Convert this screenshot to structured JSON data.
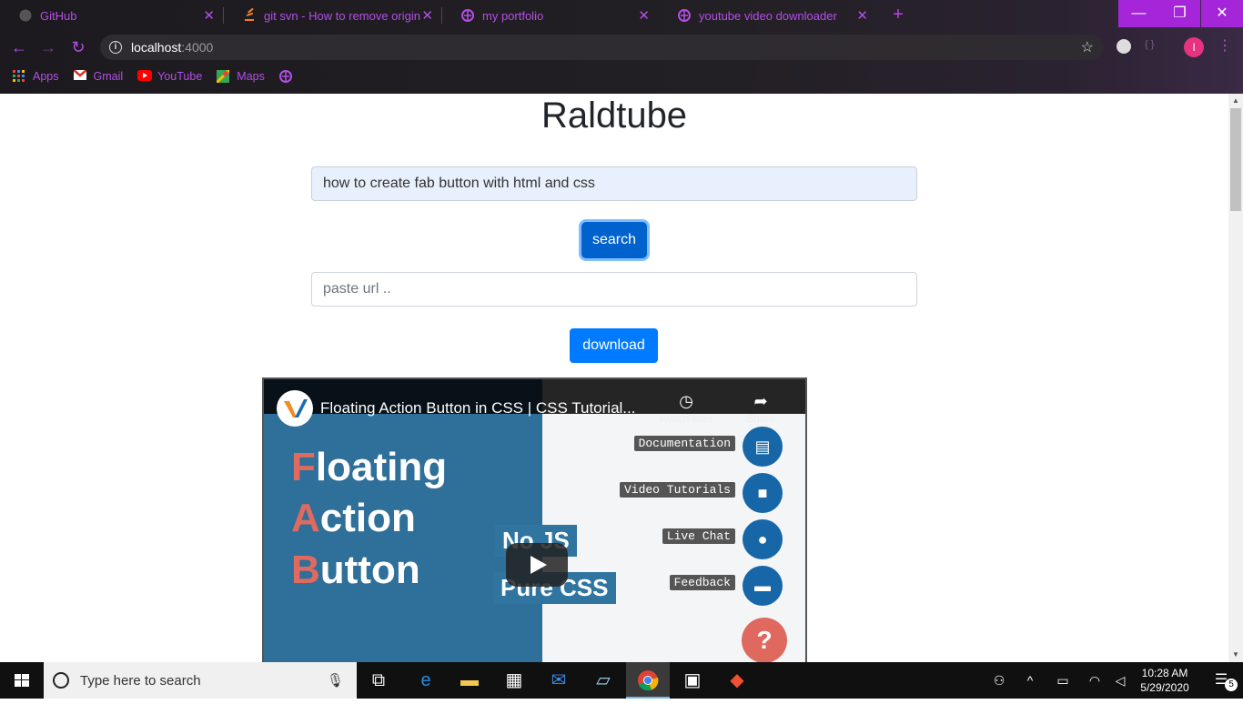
{
  "browser": {
    "tabs": [
      {
        "label": "GitHub",
        "favicon": "github-icon"
      },
      {
        "label": "git svn - How to remove origin fr",
        "favicon": "stackoverflow-icon"
      },
      {
        "label": "my portfolio",
        "favicon": "globe-icon"
      },
      {
        "label": "youtube video downloader",
        "favicon": "globe-icon"
      }
    ],
    "address": {
      "host": "localhost",
      "port": ":4000"
    },
    "bookmarks": [
      {
        "label": "Apps",
        "icon": "apps-grid-icon"
      },
      {
        "label": "Gmail",
        "icon": "gmail-icon"
      },
      {
        "label": "YouTube",
        "icon": "youtube-icon"
      },
      {
        "label": "Maps",
        "icon": "maps-icon"
      }
    ],
    "profile_initial": "I",
    "accent": "#b44ee8"
  },
  "page": {
    "title": "Raldtube",
    "search_value": "how to create fab button with html and css",
    "search_button": "search",
    "url_placeholder": "paste url ..",
    "download_button": "download"
  },
  "video": {
    "title": "Floating Action Button in CSS | CSS Tutorial...",
    "watch_later": "Watch later",
    "share": "Share",
    "headline": {
      "w1_cap": "F",
      "w1_rest": "loating",
      "w2_cap": "A",
      "w2_rest": "ction",
      "w3_cap": "B",
      "w3_rest": "utton"
    },
    "tag1": "No JS",
    "tag2": "Pure CSS",
    "fab_items": [
      "Documentation",
      "Video Tutorials",
      "Live Chat",
      "Feedback"
    ],
    "help": "?"
  },
  "taskbar": {
    "search_placeholder": "Type here to search",
    "time": "10:28 AM",
    "date": "5/29/2020",
    "notifications": "5"
  }
}
